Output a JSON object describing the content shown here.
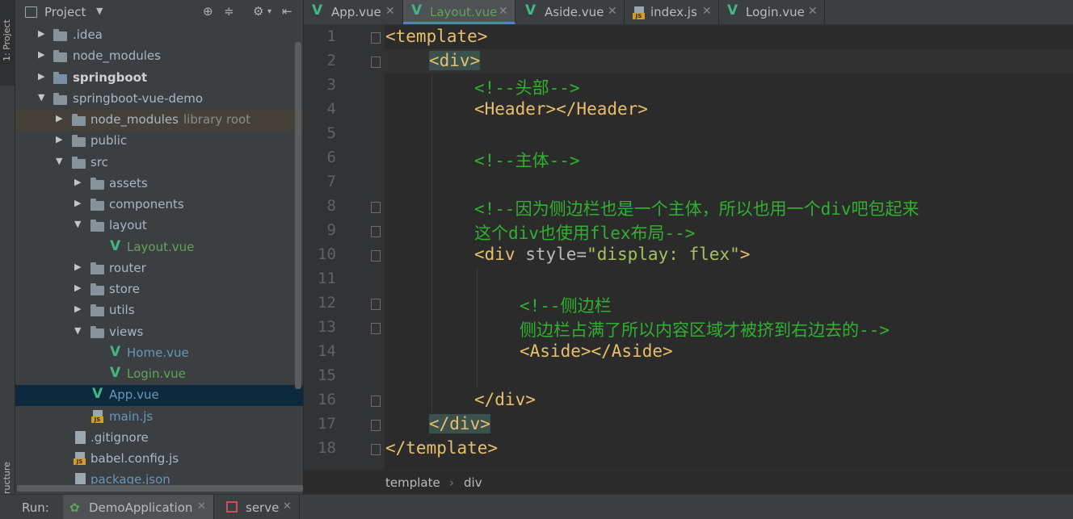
{
  "left_strip": {
    "project_tab": "1: Project",
    "structure_tab": "Z: Structure"
  },
  "panel": {
    "title": "Project"
  },
  "tree": [
    {
      "label": "idea",
      "display": ".idea"
    },
    {
      "display": "node_modules"
    },
    {
      "display": "springboot"
    },
    {
      "display": "springboot-vue-demo"
    },
    {
      "display": "node_modules",
      "note": "library root"
    },
    {
      "display": "public"
    },
    {
      "display": "src"
    },
    {
      "display": "assets"
    },
    {
      "display": "components"
    },
    {
      "display": "layout"
    },
    {
      "display": "Layout.vue"
    },
    {
      "display": "router"
    },
    {
      "display": "store"
    },
    {
      "display": "utils"
    },
    {
      "display": "views"
    },
    {
      "display": "Home.vue"
    },
    {
      "display": "Login.vue"
    },
    {
      "display": "App.vue"
    },
    {
      "display": "main.js"
    },
    {
      "display": ".gitignore"
    },
    {
      "display": "babel.config.js"
    },
    {
      "display": "package.json"
    }
  ],
  "tabs": [
    "App.vue",
    "Layout.vue",
    "Aside.vue",
    "index.js",
    "Login.vue"
  ],
  "line_numbers": [
    "1",
    "2",
    "3",
    "4",
    "5",
    "6",
    "7",
    "8",
    "9",
    "10",
    "11",
    "12",
    "13",
    "14",
    "15",
    "16",
    "17",
    "18"
  ],
  "code": {
    "l1": "<template>",
    "l2": "<div>",
    "l3": "<!--头部-->",
    "l4": "<Header></Header>",
    "l6": "<!--主体-->",
    "l8": "<!--因为侧边栏也是一个主体，所以也用一个div吧包起来",
    "l9": "这个div也使用flex布局-->",
    "l10_open": "<div ",
    "l10_attr": "style=",
    "l10_val": "\"display: flex\"",
    "l10_close": ">",
    "l12": "<!--侧边栏",
    "l13": "侧边栏占满了所以内容区域才被挤到右边去的-->",
    "l14": "<Aside></Aside>",
    "l16": "</div>",
    "l17": "</div>",
    "l18": "</template>"
  },
  "breadcrumb": {
    "first": "template",
    "sep": "›",
    "second": "div"
  },
  "runbar": {
    "label": "Run:",
    "config": "DemoApplication",
    "serve": "serve"
  }
}
